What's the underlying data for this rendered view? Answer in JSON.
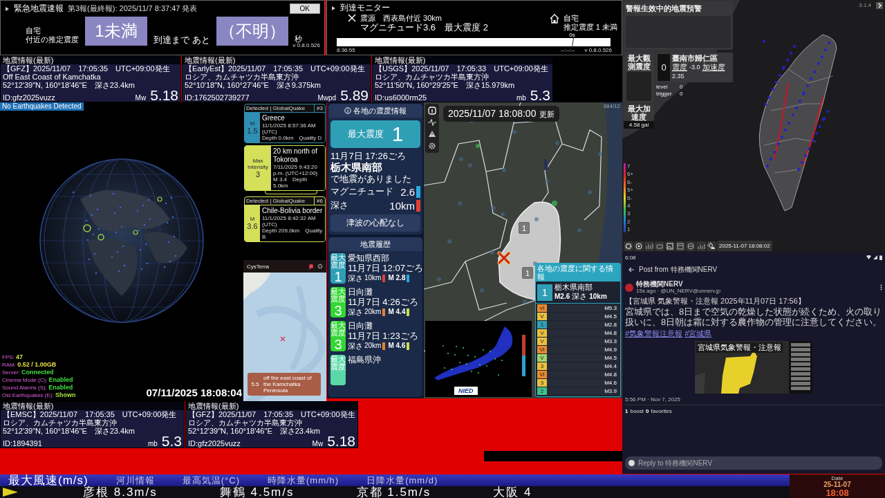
{
  "eew": {
    "title": "緊急地震速報",
    "report": "第3報(最終報): 2025/11/7 8:37:47 発表",
    "ok_button": "OK",
    "home_label": "自宅",
    "intensity_label": "付近の推定震度",
    "intensity": "1未満",
    "arrival_label": "到達まで あと",
    "arrival": "（不明）",
    "seconds_unit": "秒",
    "version": "v 0.8.0.526"
  },
  "arrival_monitor": {
    "title": "到達モニター",
    "epicenter": "震源　西表島付近 30km",
    "magnitude": "マグニチュード3.6　最大震度 2",
    "home_label": "自宅",
    "home_intensity": "推定震度 1 未満",
    "marker": "0s",
    "level": 0.86,
    "start_time": "8:36:55",
    "end_time": "--:--:--",
    "version": "v 0.8.0.526"
  },
  "quake_cards_top": [
    {
      "header": "地震情報(最新)",
      "source_line": "【GFZ】2025/11/07　17:05:35　UTC+09:00発生",
      "region": "Off East Coast of Kamchatka",
      "location": "52°12'39\"N, 160°18'46\"E　深さ23.4km",
      "id": "ID:gfz2025vuzz",
      "mag_type": "Mw",
      "mag": "5.18"
    },
    {
      "header": "地震情報(最新)",
      "source_line": "【EarlyEst】2025/11/07　17:05:35　UTC+09:00発生",
      "region": "ロシア、カムチャツカ半島東方沖",
      "location": "52°10'18\"N, 160°27'46\"E　深さ9.375km",
      "id": "ID:1762502739277",
      "mag_type": "Mwpd",
      "mag": "5.89"
    },
    {
      "header": "地震情報(最新)",
      "source_line": "【USGS】2025/11/07　17:05:33　UTC+09:00発生",
      "region": "ロシア、カムチャツカ半島東方沖",
      "location": "52°11'50\"N, 160°29'25\"E　深さ15.979km",
      "id": "ID:us6000rm25",
      "mag_type": "mb",
      "mag": "5.3"
    }
  ],
  "globe": {
    "status": "No Earthquakes Detected",
    "stats": [
      {
        "label": "FPS:",
        "value": "47",
        "color": "#d8e84a"
      },
      {
        "label": "RAM:",
        "value": "0.52 / 1.00GB",
        "color": "#e8e040"
      },
      {
        "label": "Server:",
        "value": "Connected",
        "color": "#40e040"
      },
      {
        "label": "Cinema Mode (C):",
        "value": "Enabled",
        "color": "#40e040"
      },
      {
        "label": "Sound Alarms (S):",
        "value": "Enabled",
        "color": "#40e040"
      },
      {
        "label": "Old Earthquakes (E):",
        "value": "Shown",
        "color": "#a8e040"
      }
    ],
    "clock": "07/11/2025 18:08:04"
  },
  "globalquake": [
    {
      "kind": "detected",
      "header": "Detected | GlobalQuake",
      "number": "#3",
      "badge_label": "M",
      "badge_value": "1.5",
      "place": "Greece",
      "time": "11/1/2025 8:57:36 AM (UTC)",
      "details": "Depth 0.0km　Quality D",
      "color": "#2e8fb3"
    },
    {
      "kind": "intensity",
      "badge_label": "Max Intensity",
      "badge_value": "3",
      "place": "20 km north of Tokoroa",
      "time": "7/11/2025 9:43:20 p.m. (UTC+12:00)",
      "details": "M 3.4　Depth 5.0km",
      "color": "#d4e05a"
    },
    {
      "kind": "detected",
      "header": "Detected | GlobalQuake",
      "number": "#6",
      "badge_label": "M",
      "badge_value": "3.6",
      "place": "Chile-Bolivia border",
      "time": "11/1/2025 8:42:32 AM (UTC)",
      "details": "Depth 209.0km　Quality B",
      "color": "#d4e05a"
    }
  ],
  "map_app": {
    "title": "CysTerra",
    "popup_mag": "5.5",
    "popup_title": "off the east coast of the Kamchatka Peninsula"
  },
  "shindo": {
    "title": "各地の震度情報",
    "max_label": "最大震度",
    "max_value": "1",
    "time": "11月7日 17:26ごろ",
    "region": "栃木県南部",
    "note": "で地震がありました",
    "magnitude": {
      "label": "マグニチュード",
      "value": "2.6",
      "color": "#2aa8e0"
    },
    "depth": {
      "label": "深さ",
      "value": "10km",
      "color": "#e04030"
    },
    "tsunami": "津波の心配なし",
    "history_title": "地震履歴",
    "history": [
      {
        "intensity_label": "最大震度",
        "intensity": "1",
        "color": "#2f9fb5",
        "region": "愛知県西部",
        "time": "11月7日 12:07ごろ",
        "depth": {
          "label": "深さ",
          "value": "10km",
          "color": "#e04030"
        },
        "magnitude": {
          "value": "M 2.8",
          "color": "#2aa8e0"
        }
      },
      {
        "intensity_label": "最大震度",
        "intensity": "3",
        "color": "#33d633",
        "region": "日向灘",
        "time": "11月7日 4:26ごろ",
        "depth": {
          "label": "深さ",
          "value": "20km",
          "color": "#e8802a"
        },
        "magnitude": {
          "value": "M 4.4",
          "color": "#c8e050"
        }
      },
      {
        "intensity_label": "最大震度",
        "intensity": "3",
        "color": "#33d633",
        "region": "日向灘",
        "time": "11月7日 1:23ごろ",
        "depth": {
          "label": "深さ",
          "value": "20km",
          "color": "#e8802a"
        },
        "magnitude": {
          "value": "M 4.6",
          "color": "#c8e050"
        }
      },
      {
        "intensity_label": "最大震度",
        "color": "#5ad8a8",
        "region": "福島県沖"
      }
    ]
  },
  "kmoni": {
    "timestamp": "2025/11/07 18:08:00",
    "updated": "更新",
    "version": "384/12",
    "area_marks": [
      "1",
      "1"
    ],
    "info": {
      "title": "各地の震度に関する情報",
      "intensity": "1",
      "region": "栃木県南部",
      "mag": "M2.6",
      "depth_label": "深さ",
      "depth": "10km",
      "list": [
        {
          "intensity": "VI",
          "mag": "M5.3",
          "color": "#e88a2e"
        },
        {
          "intensity": "V",
          "mag": "M4.5",
          "color": "#e9c040"
        },
        {
          "intensity": "1",
          "mag": "M2.8",
          "color": "#2f9fb5"
        },
        {
          "intensity": "V",
          "mag": "M4.8",
          "color": "#e9c040"
        },
        {
          "intensity": "V",
          "mag": "M3.3",
          "color": "#e9c040"
        },
        {
          "intensity": "VI",
          "mag": "M4.9",
          "color": "#e88a2e"
        },
        {
          "intensity": "V",
          "mag": "M4.5",
          "color": "#9fd36a"
        },
        {
          "intensity": "3",
          "mag": "M4.4",
          "color": "#e9c040"
        },
        {
          "intensity": "VI",
          "mag": "M4.8",
          "color": "#e88a2e"
        },
        {
          "intensity": "3",
          "mag": "M4.6",
          "color": "#e9c040"
        },
        {
          "intensity": "2",
          "mag": "M3.9",
          "color": "#3cc08a"
        }
      ]
    },
    "inset_logo": "NIED"
  },
  "taiwan": {
    "version": "3.1.4",
    "alert_title": "警報生效中的地震預警",
    "max_intensity_label": "最大觀測震度",
    "station_value": "0",
    "station_name": "臺南市歸仁區",
    "station_intensity_label": "震度",
    "station_intensity": "-3.0",
    "station_pga_label": "加速度",
    "station_pga": "2.35",
    "level_label": "level",
    "level_value": "0",
    "trigger_label": "trigger",
    "trigger_value": "0",
    "max_pga_label": "最大加速度",
    "max_pga": "4.58 gal",
    "scale": [
      "7",
      "6+",
      "6-",
      "5+",
      "5-",
      "4",
      "3",
      "2",
      "1"
    ],
    "timestamp": "2025-11-07 18:08:02"
  },
  "post": {
    "status_time": "6:08",
    "header": "Post from 特務機関NERV",
    "author": "特務機関NERV",
    "meta": "15s ago · @UN_NERV@unnerv.jp",
    "title": "【宮城県 気象警報・注意報 2025年11月07日 17:56】",
    "body": "宮城県では、8日まで空気の乾燥した状態が続くため、火の取り扱いに、8日朝は霜に対する農作物の管理に注意してください。",
    "tags": [
      "#気象警報注意報",
      "#宮城県"
    ],
    "image_title": "宮城県気象警報・注意報",
    "timestamp": "5:56 PM · Nov 7, 2025",
    "boosts": "1",
    "boosts_label": "boost",
    "favorites": "0",
    "favorites_label": "favorites",
    "reply_placeholder": "Reply to 特務機関NERV"
  },
  "quake_cards_bottom": [
    {
      "header": "地震情報(最新)",
      "source_line": "【EMSC】2025/11/07　17:05:35　UTC+09:00発生",
      "region": "ロシア、カムチャツカ半島東方沖",
      "location": "52°12'39\"N, 160°18'46\"E　深さ23.4km",
      "id": "ID:1894391",
      "mag_type": "mb",
      "mag": "5.3"
    },
    {
      "header": "地震情報(最新)",
      "source_line": "【GFZ】2025/11/07　17:05:35　UTC+09:00発生",
      "region": "ロシア、カムチャツカ半島東方沖",
      "location": "52°12'39\"N, 160°18'46\"E　深さ23.4km",
      "id": "ID:gfz2025vuzz",
      "mag_type": "Mw",
      "mag": "5.18"
    }
  ],
  "ticker": {
    "categories": [
      {
        "label": "最大風速(m/s)",
        "selected": true
      },
      {
        "label": "河川情報",
        "selected": false
      },
      {
        "label": "最高気温(°C)",
        "selected": false
      },
      {
        "label": "時降水量(mm/h)",
        "selected": false
      },
      {
        "label": "日降水量(mm/d)",
        "selected": false
      }
    ],
    "items": [
      "彦根 8.3m/s",
      "舞鶴 4.5m/s",
      "京都 1.5m/s",
      "大阪 4"
    ],
    "date_label": "Date",
    "date": "25-11-07",
    "time": "18:08"
  }
}
